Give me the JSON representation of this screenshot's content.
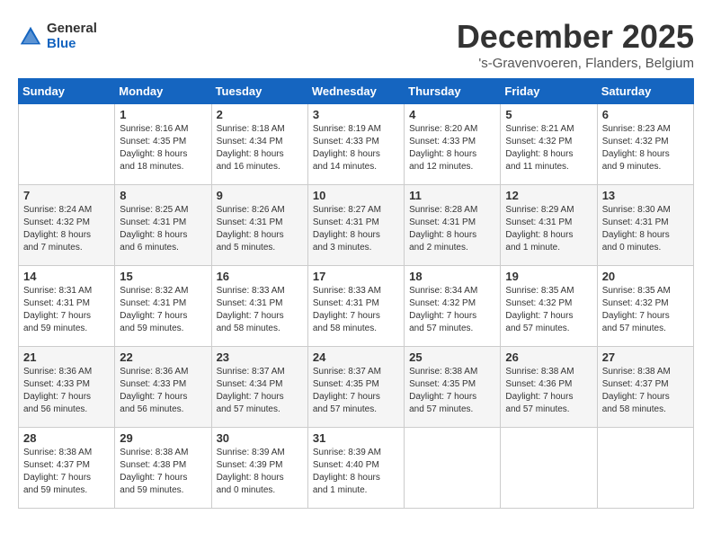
{
  "header": {
    "logo_general": "General",
    "logo_blue": "Blue",
    "month": "December 2025",
    "location": "'s-Gravenvoeren, Flanders, Belgium"
  },
  "columns": [
    "Sunday",
    "Monday",
    "Tuesday",
    "Wednesday",
    "Thursday",
    "Friday",
    "Saturday"
  ],
  "weeks": [
    {
      "days": [
        {
          "num": "",
          "info": ""
        },
        {
          "num": "1",
          "info": "Sunrise: 8:16 AM\nSunset: 4:35 PM\nDaylight: 8 hours\nand 18 minutes."
        },
        {
          "num": "2",
          "info": "Sunrise: 8:18 AM\nSunset: 4:34 PM\nDaylight: 8 hours\nand 16 minutes."
        },
        {
          "num": "3",
          "info": "Sunrise: 8:19 AM\nSunset: 4:33 PM\nDaylight: 8 hours\nand 14 minutes."
        },
        {
          "num": "4",
          "info": "Sunrise: 8:20 AM\nSunset: 4:33 PM\nDaylight: 8 hours\nand 12 minutes."
        },
        {
          "num": "5",
          "info": "Sunrise: 8:21 AM\nSunset: 4:32 PM\nDaylight: 8 hours\nand 11 minutes."
        },
        {
          "num": "6",
          "info": "Sunrise: 8:23 AM\nSunset: 4:32 PM\nDaylight: 8 hours\nand 9 minutes."
        }
      ]
    },
    {
      "days": [
        {
          "num": "7",
          "info": "Sunrise: 8:24 AM\nSunset: 4:32 PM\nDaylight: 8 hours\nand 7 minutes."
        },
        {
          "num": "8",
          "info": "Sunrise: 8:25 AM\nSunset: 4:31 PM\nDaylight: 8 hours\nand 6 minutes."
        },
        {
          "num": "9",
          "info": "Sunrise: 8:26 AM\nSunset: 4:31 PM\nDaylight: 8 hours\nand 5 minutes."
        },
        {
          "num": "10",
          "info": "Sunrise: 8:27 AM\nSunset: 4:31 PM\nDaylight: 8 hours\nand 3 minutes."
        },
        {
          "num": "11",
          "info": "Sunrise: 8:28 AM\nSunset: 4:31 PM\nDaylight: 8 hours\nand 2 minutes."
        },
        {
          "num": "12",
          "info": "Sunrise: 8:29 AM\nSunset: 4:31 PM\nDaylight: 8 hours\nand 1 minute."
        },
        {
          "num": "13",
          "info": "Sunrise: 8:30 AM\nSunset: 4:31 PM\nDaylight: 8 hours\nand 0 minutes."
        }
      ]
    },
    {
      "days": [
        {
          "num": "14",
          "info": "Sunrise: 8:31 AM\nSunset: 4:31 PM\nDaylight: 7 hours\nand 59 minutes."
        },
        {
          "num": "15",
          "info": "Sunrise: 8:32 AM\nSunset: 4:31 PM\nDaylight: 7 hours\nand 59 minutes."
        },
        {
          "num": "16",
          "info": "Sunrise: 8:33 AM\nSunset: 4:31 PM\nDaylight: 7 hours\nand 58 minutes."
        },
        {
          "num": "17",
          "info": "Sunrise: 8:33 AM\nSunset: 4:31 PM\nDaylight: 7 hours\nand 58 minutes."
        },
        {
          "num": "18",
          "info": "Sunrise: 8:34 AM\nSunset: 4:32 PM\nDaylight: 7 hours\nand 57 minutes."
        },
        {
          "num": "19",
          "info": "Sunrise: 8:35 AM\nSunset: 4:32 PM\nDaylight: 7 hours\nand 57 minutes."
        },
        {
          "num": "20",
          "info": "Sunrise: 8:35 AM\nSunset: 4:32 PM\nDaylight: 7 hours\nand 57 minutes."
        }
      ]
    },
    {
      "days": [
        {
          "num": "21",
          "info": "Sunrise: 8:36 AM\nSunset: 4:33 PM\nDaylight: 7 hours\nand 56 minutes."
        },
        {
          "num": "22",
          "info": "Sunrise: 8:36 AM\nSunset: 4:33 PM\nDaylight: 7 hours\nand 56 minutes."
        },
        {
          "num": "23",
          "info": "Sunrise: 8:37 AM\nSunset: 4:34 PM\nDaylight: 7 hours\nand 57 minutes."
        },
        {
          "num": "24",
          "info": "Sunrise: 8:37 AM\nSunset: 4:35 PM\nDaylight: 7 hours\nand 57 minutes."
        },
        {
          "num": "25",
          "info": "Sunrise: 8:38 AM\nSunset: 4:35 PM\nDaylight: 7 hours\nand 57 minutes."
        },
        {
          "num": "26",
          "info": "Sunrise: 8:38 AM\nSunset: 4:36 PM\nDaylight: 7 hours\nand 57 minutes."
        },
        {
          "num": "27",
          "info": "Sunrise: 8:38 AM\nSunset: 4:37 PM\nDaylight: 7 hours\nand 58 minutes."
        }
      ]
    },
    {
      "days": [
        {
          "num": "28",
          "info": "Sunrise: 8:38 AM\nSunset: 4:37 PM\nDaylight: 7 hours\nand 59 minutes."
        },
        {
          "num": "29",
          "info": "Sunrise: 8:38 AM\nSunset: 4:38 PM\nDaylight: 7 hours\nand 59 minutes."
        },
        {
          "num": "30",
          "info": "Sunrise: 8:39 AM\nSunset: 4:39 PM\nDaylight: 8 hours\nand 0 minutes."
        },
        {
          "num": "31",
          "info": "Sunrise: 8:39 AM\nSunset: 4:40 PM\nDaylight: 8 hours\nand 1 minute."
        },
        {
          "num": "",
          "info": ""
        },
        {
          "num": "",
          "info": ""
        },
        {
          "num": "",
          "info": ""
        }
      ]
    }
  ]
}
